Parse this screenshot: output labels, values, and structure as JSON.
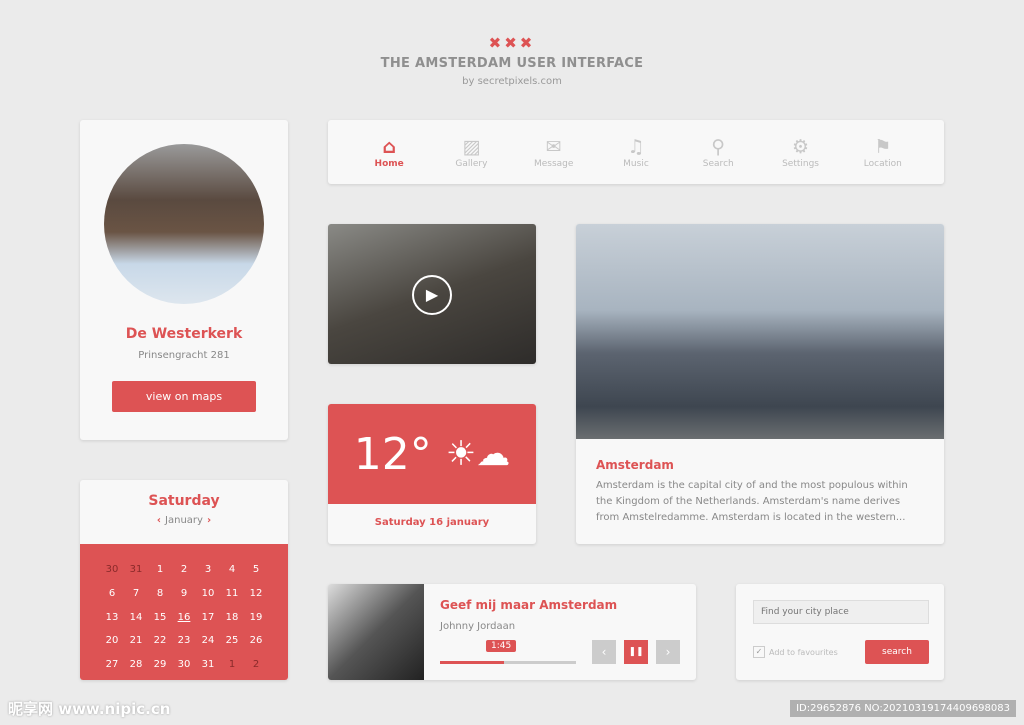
{
  "header": {
    "logo": "✖✖✖",
    "title": "THE AMSTERDAM USER INTERFACE",
    "subtitle": "by secretpixels.com"
  },
  "profile": {
    "name": "De Westerkerk",
    "address": "Prinsengracht 281",
    "button": "view on maps"
  },
  "nav": {
    "items": [
      {
        "label": "Home",
        "icon": "⌂",
        "active": true
      },
      {
        "label": "Gallery",
        "icon": "▨"
      },
      {
        "label": "Message",
        "icon": "✉"
      },
      {
        "label": "Music",
        "icon": "♫"
      },
      {
        "label": "Search",
        "icon": "⚲"
      },
      {
        "label": "Settings",
        "icon": "⚙"
      },
      {
        "label": "Location",
        "icon": "⚑"
      }
    ]
  },
  "video": {
    "play_icon": "▶"
  },
  "weather": {
    "temp": "12°",
    "icon": "☀☁",
    "date": "Saturday 16 january"
  },
  "city": {
    "title": "Amsterdam",
    "text": "Amsterdam is the capital city of and the most populous within the Kingdom of the Netherlands. Amsterdam's name derives from Amstelredamme. Amsterdam is located in the western..."
  },
  "calendar": {
    "day": "Saturday",
    "month": "January",
    "prev": "‹",
    "next": "›",
    "today": "16",
    "days": [
      "30",
      "31",
      "1",
      "2",
      "3",
      "4",
      "5",
      "6",
      "7",
      "8",
      "9",
      "10",
      "11",
      "12",
      "13",
      "14",
      "15",
      "16",
      "17",
      "18",
      "19",
      "20",
      "21",
      "22",
      "23",
      "24",
      "25",
      "26",
      "27",
      "28",
      "29",
      "30",
      "31",
      "1",
      "2"
    ]
  },
  "music": {
    "title": "Geef mij maar Amsterdam",
    "artist": "Johnny Jordaan",
    "time": "1:45",
    "progress": 0.47,
    "prev": "‹",
    "pause": "❚❚",
    "next": "›"
  },
  "search": {
    "placeholder": "Find your city place",
    "favourite": "Add to favourites",
    "favourite_checked": true,
    "button": "search"
  },
  "watermark": {
    "site": "昵享网 www.nipic.cn",
    "id": "ID:29652876 NO:20210319174409698083"
  },
  "colors": {
    "accent": "#dd5354",
    "background": "#ebebeb"
  }
}
